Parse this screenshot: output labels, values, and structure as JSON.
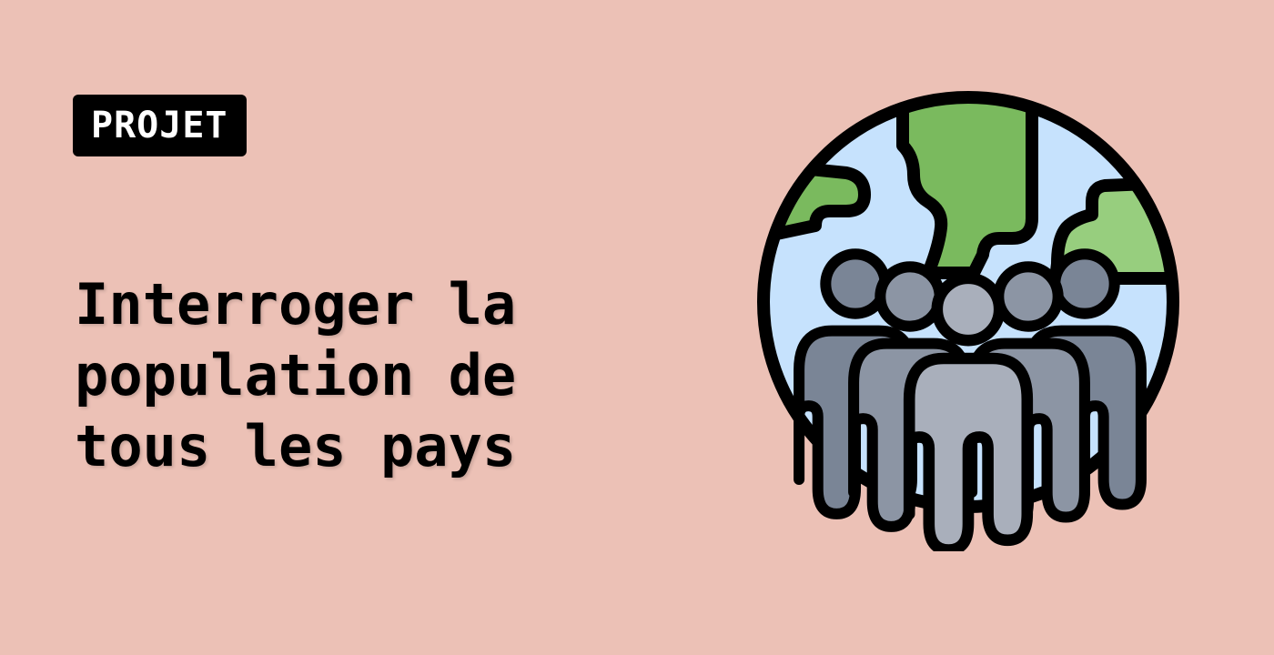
{
  "badge": {
    "label": "PROJET"
  },
  "title": {
    "lines": [
      "Interroger la",
      "population de",
      "tous les pays"
    ]
  },
  "illustration": {
    "icon": "globe-with-crowd-icon"
  },
  "colors": {
    "background": "#ecc1b6",
    "badge_bg": "#000000",
    "badge_text": "#ffffff",
    "ocean": "#c6e2fd",
    "land_dark": "#7aba5e",
    "land_light": "#97ce7e",
    "person_dark": "#7a8596",
    "person_mid": "#8c95a4",
    "person_light": "#a9afbb",
    "outline": "#000000"
  }
}
